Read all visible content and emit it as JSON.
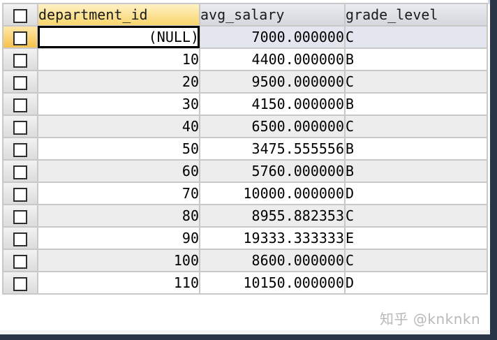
{
  "columns": {
    "department_id": "department_id",
    "avg_salary": "avg_salary",
    "grade_level": "grade_level"
  },
  "rows": [
    {
      "department_id": "(NULL)",
      "avg_salary": "7000.000000",
      "grade_level": "C"
    },
    {
      "department_id": "10",
      "avg_salary": "4400.000000",
      "grade_level": "B"
    },
    {
      "department_id": "20",
      "avg_salary": "9500.000000",
      "grade_level": "C"
    },
    {
      "department_id": "30",
      "avg_salary": "4150.000000",
      "grade_level": "B"
    },
    {
      "department_id": "40",
      "avg_salary": "6500.000000",
      "grade_level": "C"
    },
    {
      "department_id": "50",
      "avg_salary": "3475.555556",
      "grade_level": "B"
    },
    {
      "department_id": "60",
      "avg_salary": "5760.000000",
      "grade_level": "B"
    },
    {
      "department_id": "70",
      "avg_salary": "10000.000000",
      "grade_level": "D"
    },
    {
      "department_id": "80",
      "avg_salary": "8955.882353",
      "grade_level": "C"
    },
    {
      "department_id": "90",
      "avg_salary": "19333.333333",
      "grade_level": "E"
    },
    {
      "department_id": "100",
      "avg_salary": "8600.000000",
      "grade_level": "C"
    },
    {
      "department_id": "110",
      "avg_salary": "10150.000000",
      "grade_level": "D"
    }
  ],
  "watermark": "知乎 @knknkn",
  "colors": {
    "active_header": "#f8d56b",
    "alt_row": "#ededed",
    "current_row": "#e3e6ef",
    "grid_line": "#c8c8c8"
  }
}
